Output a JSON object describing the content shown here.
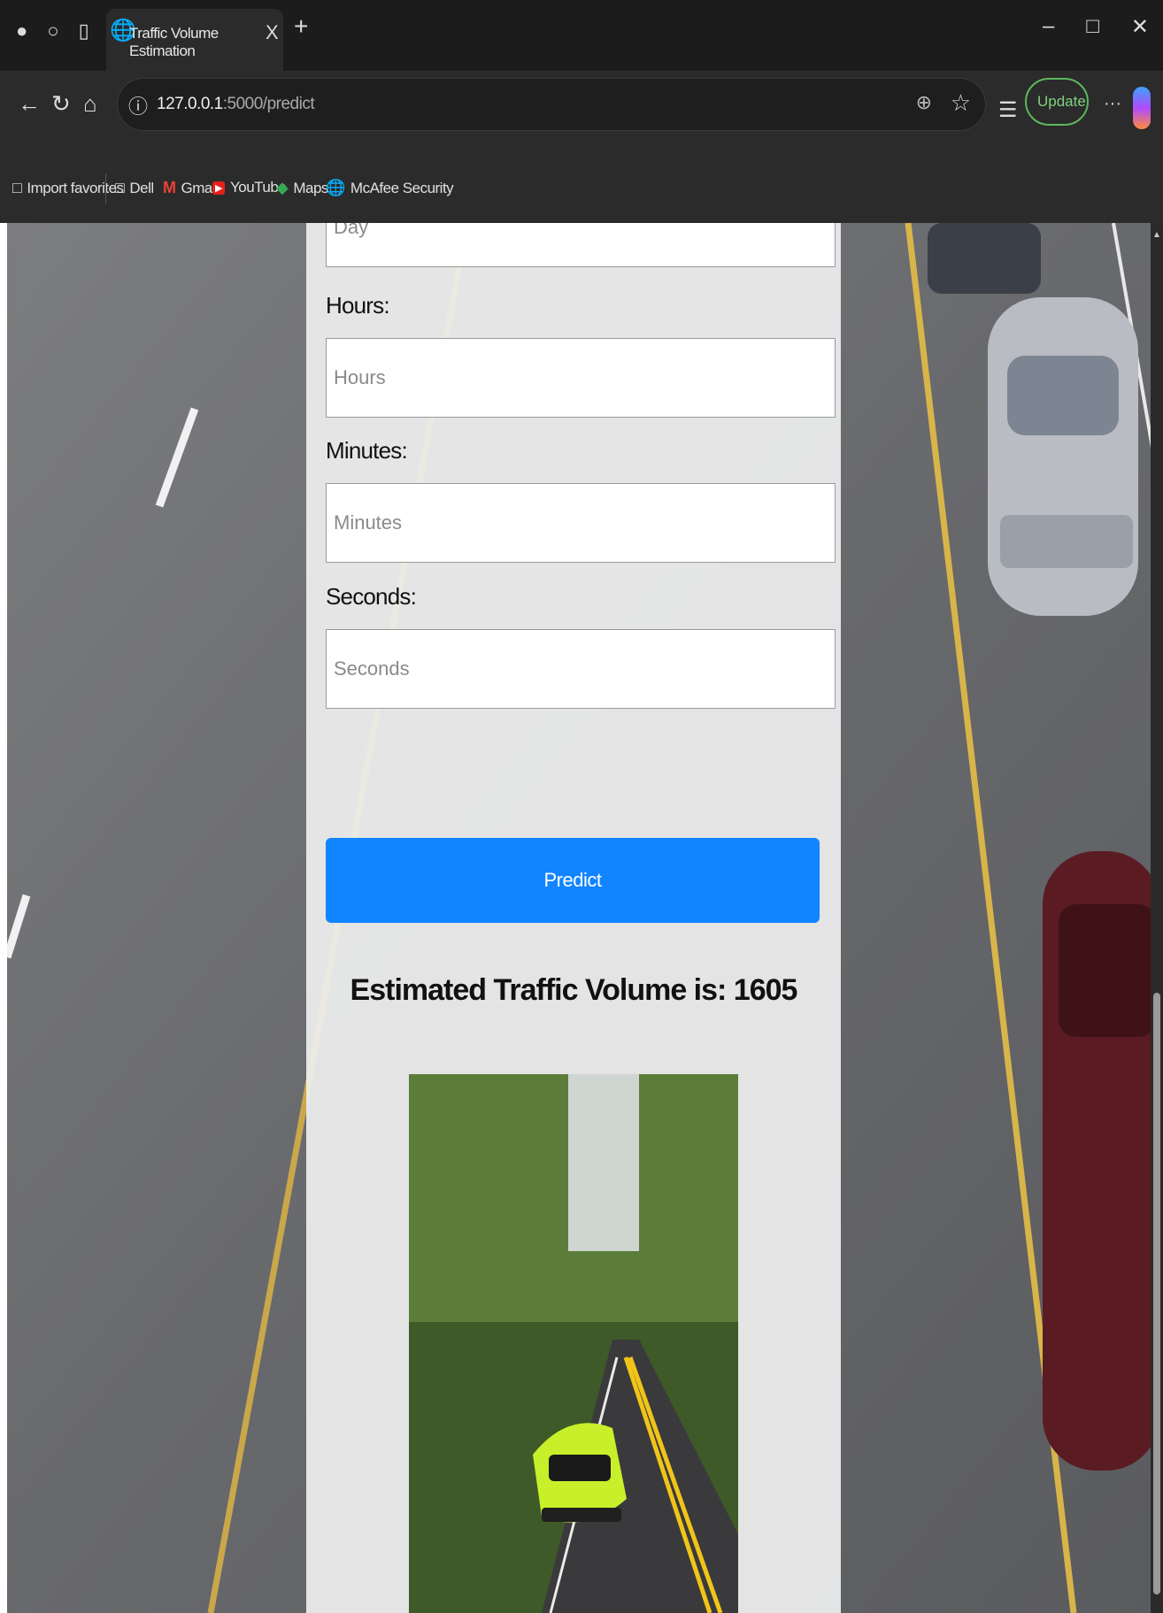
{
  "browser": {
    "tab_title": "Traffic Volume Estimation",
    "tab_close": "X",
    "new_tab": "+",
    "url_host": "127.0.0.1",
    "url_path": ":5000/predict",
    "update_label": "Update",
    "more_label": "···"
  },
  "bookmarks": [
    {
      "label": "Import favorites",
      "icon": "import-icon"
    },
    {
      "label": "Dell",
      "icon": "folder-icon"
    },
    {
      "label": "Gmail",
      "icon": "gmail-icon"
    },
    {
      "label": "YouTube",
      "icon": "youtube-icon"
    },
    {
      "label": "Maps",
      "icon": "maps-icon"
    },
    {
      "label": "McAfee Security",
      "icon": "globe-icon"
    }
  ],
  "form": {
    "day_placeholder": "Day",
    "hours_label": "Hours:",
    "hours_placeholder": "Hours",
    "minutes_label": "Minutes:",
    "minutes_placeholder": "Minutes",
    "seconds_label": "Seconds:",
    "seconds_placeholder": "Seconds",
    "predict_label": "Predict"
  },
  "result": {
    "text": "Estimated Traffic Volume is: 1605"
  },
  "colors": {
    "predict_button": "#1184ff",
    "browser_chrome": "#2b2b2b",
    "update_outline": "#5cb85c"
  }
}
